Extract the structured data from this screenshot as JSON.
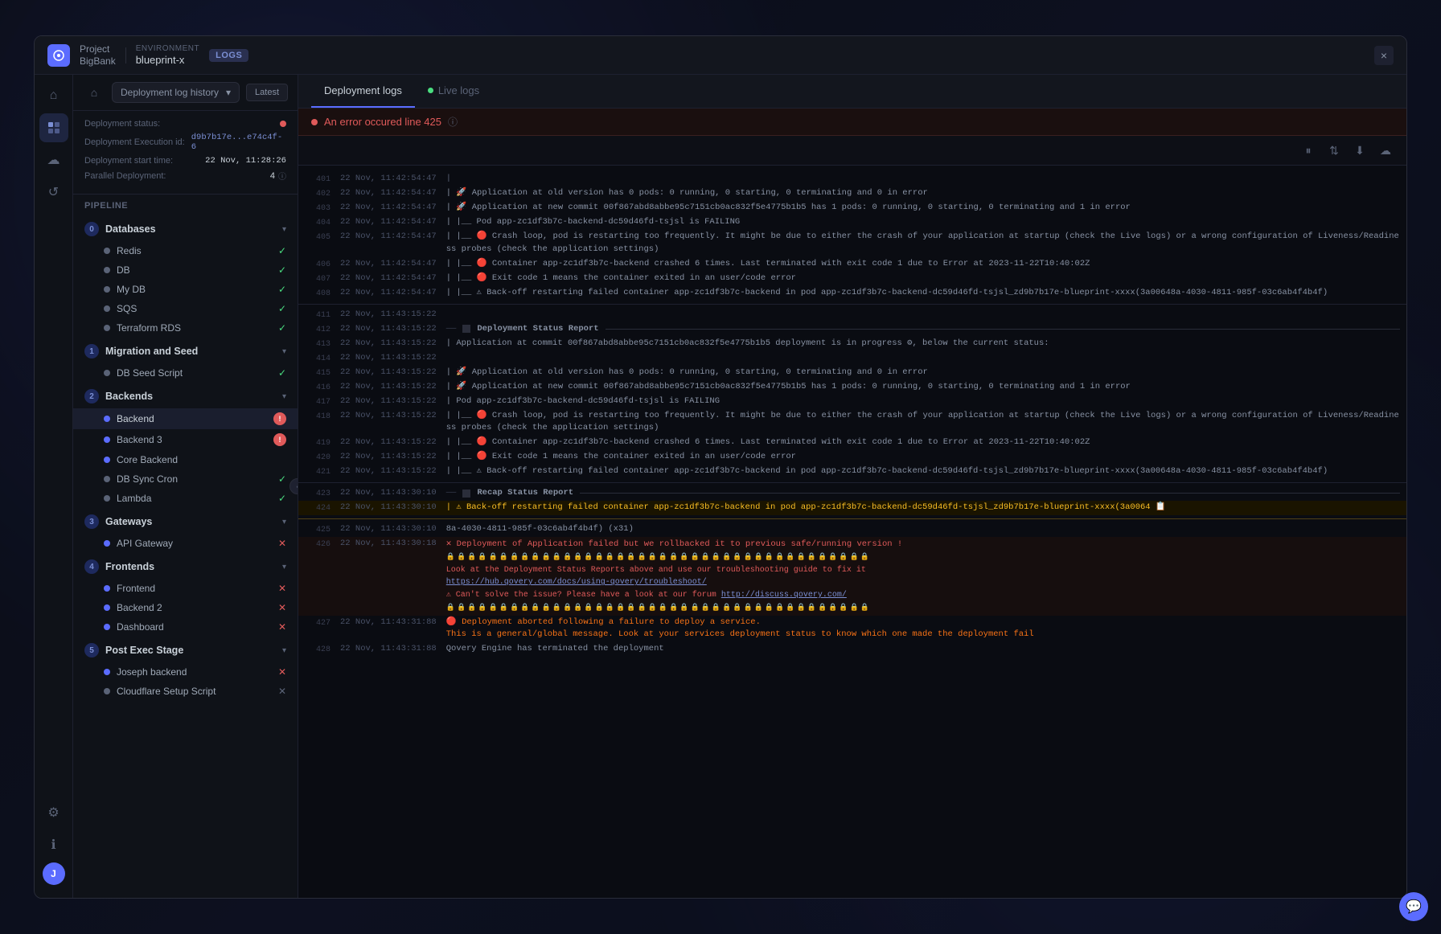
{
  "titleBar": {
    "projectLabel": "Project",
    "projectName": "BigBank",
    "envLabel": "Environment",
    "envName": "blueprint-x",
    "logsBadge": "LOGS",
    "closeBtn": "×"
  },
  "navHeader": {
    "breadcrumb": "Deployment log history",
    "latestBtn": "Latest"
  },
  "deploymentInfo": {
    "statusLabel": "Deployment status:",
    "executionLabel": "Deployment Execution id:",
    "executionValue": "d9b7b17e...e74c4f-6",
    "startLabel": "Deployment start time:",
    "startValue": "22 Nov, 11:28:26",
    "parallelLabel": "Parallel Deployment:",
    "parallelValue": "4"
  },
  "pipeline": {
    "label": "Pipeline",
    "groups": [
      {
        "number": "0",
        "name": "Databases",
        "color": "blue",
        "items": [
          {
            "name": "Redis",
            "status": "success",
            "dotColor": "gray"
          },
          {
            "name": "DB",
            "status": "success",
            "dotColor": "gray"
          },
          {
            "name": "My DB",
            "status": "success",
            "dotColor": "gray"
          },
          {
            "name": "SQS",
            "status": "success",
            "dotColor": "gray"
          },
          {
            "name": "Terraform RDS",
            "status": "success",
            "dotColor": "gray"
          }
        ]
      },
      {
        "number": "1",
        "name": "Migration and Seed",
        "color": "blue",
        "items": [
          {
            "name": "DB Seed Script",
            "status": "success",
            "dotColor": "gray"
          }
        ]
      },
      {
        "number": "2",
        "name": "Backends",
        "color": "blue",
        "items": [
          {
            "name": "Backend",
            "status": "error",
            "dotColor": "blue",
            "badge": "!"
          },
          {
            "name": "Backend 3",
            "status": "error",
            "dotColor": "blue",
            "badge": "!"
          },
          {
            "name": "Core Backend",
            "status": "active",
            "dotColor": "blue"
          },
          {
            "name": "DB Sync Cron",
            "status": "success",
            "dotColor": "gray"
          },
          {
            "name": "Lambda",
            "status": "success",
            "dotColor": "gray"
          }
        ]
      },
      {
        "number": "3",
        "name": "Gateways",
        "color": "blue",
        "items": [
          {
            "name": "API Gateway",
            "status": "error-x",
            "dotColor": "blue"
          }
        ]
      },
      {
        "number": "4",
        "name": "Frontends",
        "color": "blue",
        "items": [
          {
            "name": "Frontend",
            "status": "error-x",
            "dotColor": "blue"
          },
          {
            "name": "Backend 2",
            "status": "error-x",
            "dotColor": "blue"
          },
          {
            "name": "Dashboard",
            "status": "error-x",
            "dotColor": "blue"
          }
        ]
      },
      {
        "number": "5",
        "name": "Post Exec Stage",
        "color": "blue",
        "items": [
          {
            "name": "Joseph backend",
            "status": "error-x",
            "dotColor": "blue"
          },
          {
            "name": "Cloudflare Setup Script",
            "status": "pending",
            "dotColor": "gray"
          }
        ]
      }
    ]
  },
  "tabs": {
    "deploymentLogs": "Deployment logs",
    "liveLogs": "Live logs"
  },
  "errorBanner": {
    "text": "An error occured line 425",
    "infoIcon": "ⓘ"
  },
  "logLines": [
    {
      "num": "401",
      "time": "22 Nov, 11:42:54:47",
      "content": "|",
      "type": "gray"
    },
    {
      "num": "402",
      "time": "22 Nov, 11:42:54:47",
      "content": "| 🚀 Application at old version has 0 pods: 0 running, 0 starting, 0 terminating and 0 in error",
      "type": "normal"
    },
    {
      "num": "403",
      "time": "22 Nov, 11:42:54:47",
      "content": "| 🚀 Application at new commit 00f867abd8abbe95c7151cb0ac832f5e4775b1b5 has 1 pods: 0 running, 0 starting, 0 terminating and 1 in error",
      "type": "normal"
    },
    {
      "num": "404",
      "time": "22 Nov, 11:42:54:47",
      "content": "| |__ Pod app-zc1df3b7c-backend-dc59d46fd-tsjsl is FAILING",
      "type": "normal"
    },
    {
      "num": "405",
      "time": "22 Nov, 11:42:54:47",
      "content": "| |__ 🔴 Crash loop, pod is restarting too frequently. It might be due to either the crash of your application at startup (check the Live logs) or a wrong configuration of Liveness/Readiness probes (check the application settings)",
      "type": "normal"
    },
    {
      "num": "406",
      "time": "22 Nov, 11:42:54:47",
      "content": "| |__ 🔴 Container app-zc1df3b7c-backend crashed 6 times. Last terminated with exit code 1 due to Error  at 2023-11-22T10:40:02Z",
      "type": "normal"
    },
    {
      "num": "407",
      "time": "22 Nov, 11:42:54:47",
      "content": "| |__ 🔴 Exit code 1 means the container exited in an user/code error",
      "type": "normal"
    },
    {
      "num": "408",
      "time": "22 Nov, 11:42:54:47",
      "content": "| |__ ⚠ Back-off restarting failed container app-zc1df3b7c-backend in pod app-zc1df3b7c-backend-dc59d46fd-tsjsl_zd9b7b17e-blueprint-xxxx(3a00648a-4030-4811-985f-03c6ab4f4b4f)",
      "type": "normal"
    },
    {
      "num": "",
      "time": "",
      "content": "separator",
      "type": "separator"
    },
    {
      "num": "411",
      "time": "22 Nov, 11:43:15:22",
      "content": "",
      "type": "blank"
    },
    {
      "num": "412",
      "time": "22 Nov, 11:43:15:22",
      "content": "section-header: Deployment Status Report",
      "type": "section-header"
    },
    {
      "num": "413",
      "time": "22 Nov, 11:43:15:22",
      "content": "| Application at commit 00f867abd8abbe95c7151cb0ac832f5e4775b1b5 deployment is in progress ⚙, below the current status:",
      "type": "normal"
    },
    {
      "num": "414",
      "time": "22 Nov, 11:43:15:22",
      "content": "",
      "type": "blank"
    },
    {
      "num": "415",
      "time": "22 Nov, 11:43:15:22",
      "content": "| 🚀 Application at old version has 0 pods: 0 running, 0 starting, 0 terminating and 0 in error",
      "type": "normal"
    },
    {
      "num": "416",
      "time": "22 Nov, 11:43:15:22",
      "content": "| 🚀 Application at new commit 00f867abd8abbe95c7151cb0ac832f5e4775b1b5 has 1 pods: 0 running, 0 starting, 0 terminating and 1 in error",
      "type": "normal"
    },
    {
      "num": "417",
      "time": "22 Nov, 11:43:15:22",
      "content": "| Pod app-zc1df3b7c-backend-dc59d46fd-tsjsl is FAILING",
      "type": "normal"
    },
    {
      "num": "418",
      "time": "22 Nov, 11:43:15:22",
      "content": "| |__ 🔴 Crash loop, pod is restarting too frequently. It might be due to either the crash of your application at startup (check the Live logs) or a wrong configuration of Liveness/Readiness probes (check the application settings)",
      "type": "normal"
    },
    {
      "num": "419",
      "time": "22 Nov, 11:43:15:22",
      "content": "| |__ 🔴 Container app-zc1df3b7c-backend crashed 6 times. Last terminated with exit code 1 due to Error  at 2023-11-22T10:40:02Z",
      "type": "normal"
    },
    {
      "num": "420",
      "time": "22 Nov, 11:43:15:22",
      "content": "| |__ 🔴 Exit code 1 means the container exited in an user/code error",
      "type": "normal"
    },
    {
      "num": "421",
      "time": "22 Nov, 11:43:15:22",
      "content": "| |__ ⚠ Back-off restarting failed container app-zc1df3b7c-backend in pod app-zc1df3b7c-backend-dc59d46fd-tsjsl_zd9b7b17e-blueprint-xxxx(3a00648a-4030-4811-985f-03c6ab4f4b4f)",
      "type": "normal"
    },
    {
      "num": "",
      "time": "",
      "content": "separator",
      "type": "separator"
    },
    {
      "num": "423",
      "time": "22 Nov, 11:43:30:10",
      "content": "section-header: Recap Status Report",
      "type": "section-header2"
    },
    {
      "num": "424",
      "time": "22 Nov, 11:43:30:10",
      "content": "| ⚠ Back-off restarting failed container app-zc1df3b7c-backend in pod app-zc1df3b7c-backend-dc59d46fd-tsjsl_zd9b7b17e-blueprint-xxxx(3a0064 📋",
      "type": "highlight-active"
    },
    {
      "num": "",
      "time": "",
      "content": "separator-thin",
      "type": "separator"
    },
    {
      "num": "425",
      "time": "22 Nov, 11:43:30:10",
      "content": "8a-4030-4811-985f-03c6ab4f4b4f) (x31)",
      "type": "normal"
    },
    {
      "num": "426",
      "time": "22 Nov, 11:43:30:18",
      "content": "error-block",
      "type": "error-block"
    },
    {
      "num": "427",
      "time": "22 Nov, 11:43:31:88",
      "content": "🔴 Deployment aborted following a failure to deploy a service.\nThis is a general/global message. Look at your services deployment status to know which one made the deployment fail",
      "type": "orange-warn"
    },
    {
      "num": "428",
      "time": "22 Nov, 11:43:31:88",
      "content": "Qovery Engine has terminated the deployment",
      "type": "normal"
    }
  ]
}
